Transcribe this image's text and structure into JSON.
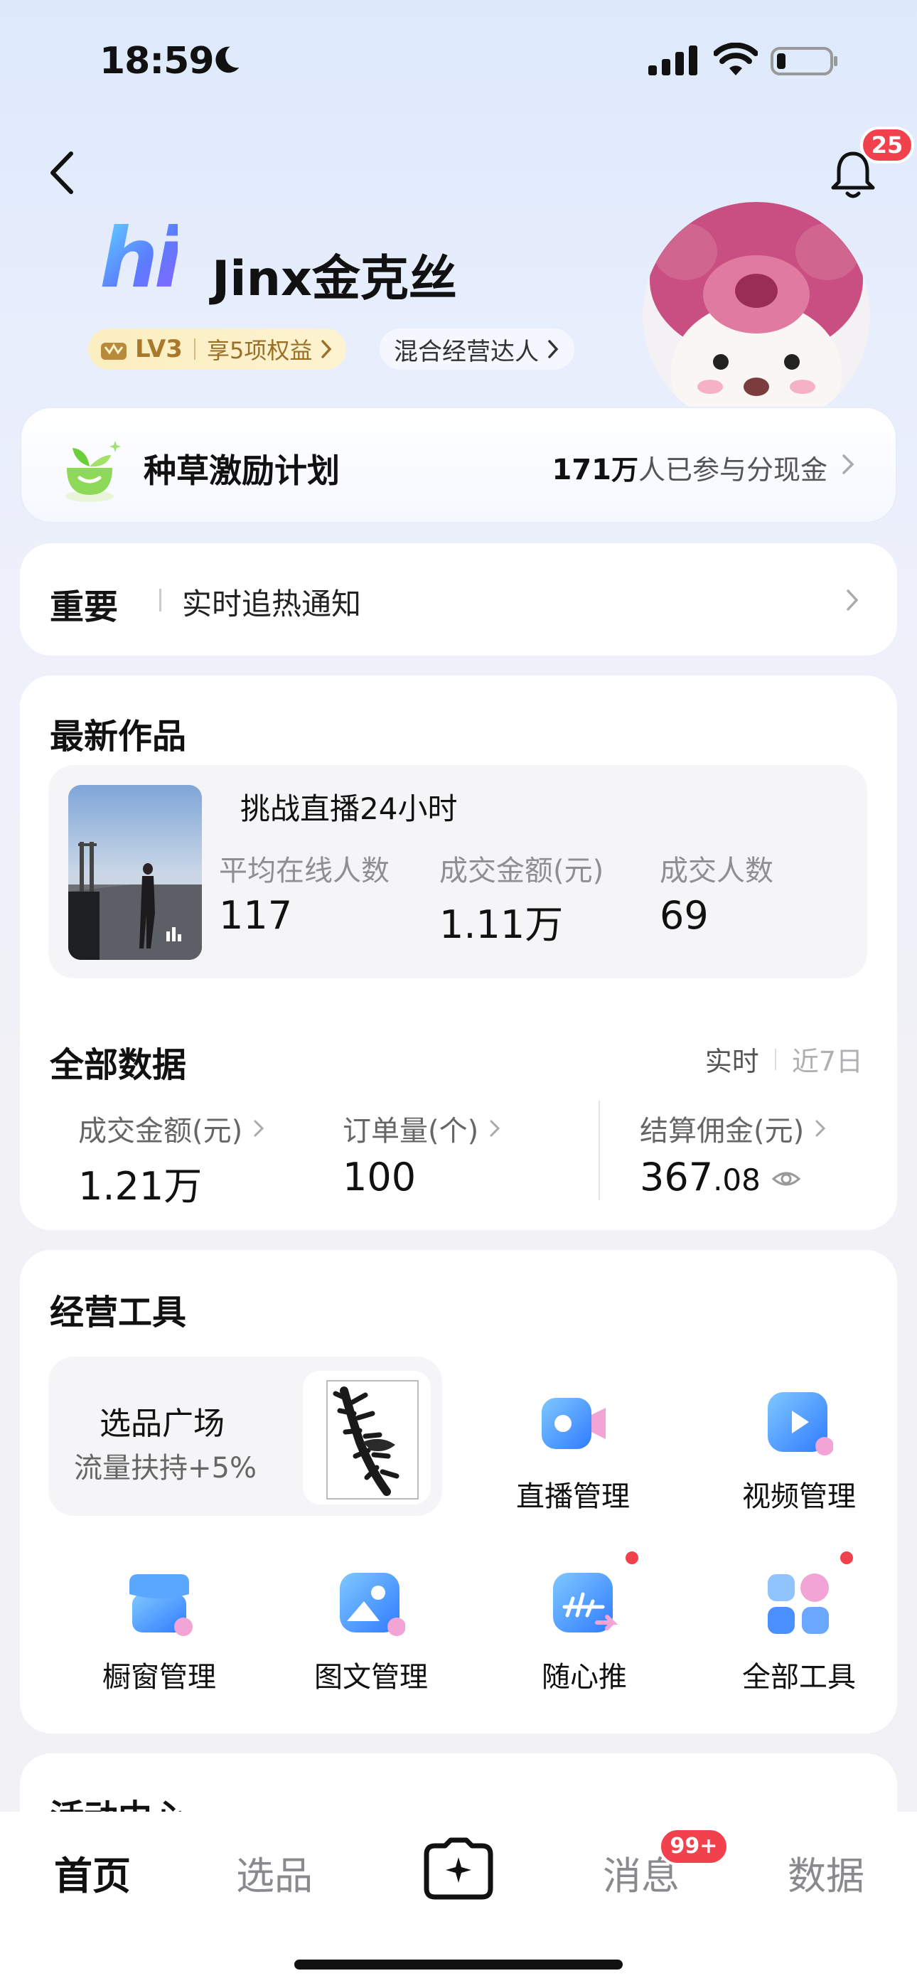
{
  "status_bar": {
    "time": "18:59"
  },
  "header": {
    "notification_count": "25",
    "logo_text": "hi",
    "username": "Jinx金克丝",
    "level": "LV3",
    "level_perk": "享5项权益",
    "role_tag": "混合经营达人"
  },
  "incentive": {
    "title": "种草激励计划",
    "participants_number": "171",
    "participants_unit": "万",
    "participants_text": "人已参与分现金"
  },
  "notice": {
    "label": "重要",
    "text": "实时追热通知"
  },
  "latest_works": {
    "title": "最新作品",
    "item": {
      "title": "挑战直播24小时",
      "metrics": [
        {
          "label": "平均在线人数",
          "value": "117"
        },
        {
          "label": "成交金额(元)",
          "value": "1.11万"
        },
        {
          "label": "成交人数",
          "value": "69"
        }
      ]
    }
  },
  "all_data": {
    "title": "全部数据",
    "range_active": "实时",
    "range_inactive": "近7日",
    "stats": [
      {
        "label": "成交金额(元)",
        "value": "1.21万"
      },
      {
        "label": "订单量(个)",
        "value": "100"
      },
      {
        "label": "结算佣金(元)",
        "value_int": "367",
        "value_dec": ".08"
      }
    ]
  },
  "tools": {
    "title": "经营工具",
    "promo": {
      "title": "选品广场",
      "subtitle": "流量扶持+5%"
    },
    "items": [
      {
        "label": "直播管理",
        "icon": "live-camera-icon"
      },
      {
        "label": "视频管理",
        "icon": "video-play-icon"
      },
      {
        "label": "橱窗管理",
        "icon": "storefront-icon"
      },
      {
        "label": "图文管理",
        "icon": "image-text-icon"
      },
      {
        "label": "随心推",
        "icon": "boost-icon"
      },
      {
        "label": "全部工具",
        "icon": "all-tools-grid-icon"
      }
    ]
  },
  "activity": {
    "title": "活动中心"
  },
  "bottom_nav": {
    "items": [
      "首页",
      "选品",
      "消息",
      "数据"
    ],
    "messages_badge": "99+"
  },
  "colors": {
    "accent_red": "#f0414d",
    "gold": "#a9782b",
    "brand_gradient_start": "#5fd6ff",
    "brand_gradient_end": "#8b62ff"
  }
}
